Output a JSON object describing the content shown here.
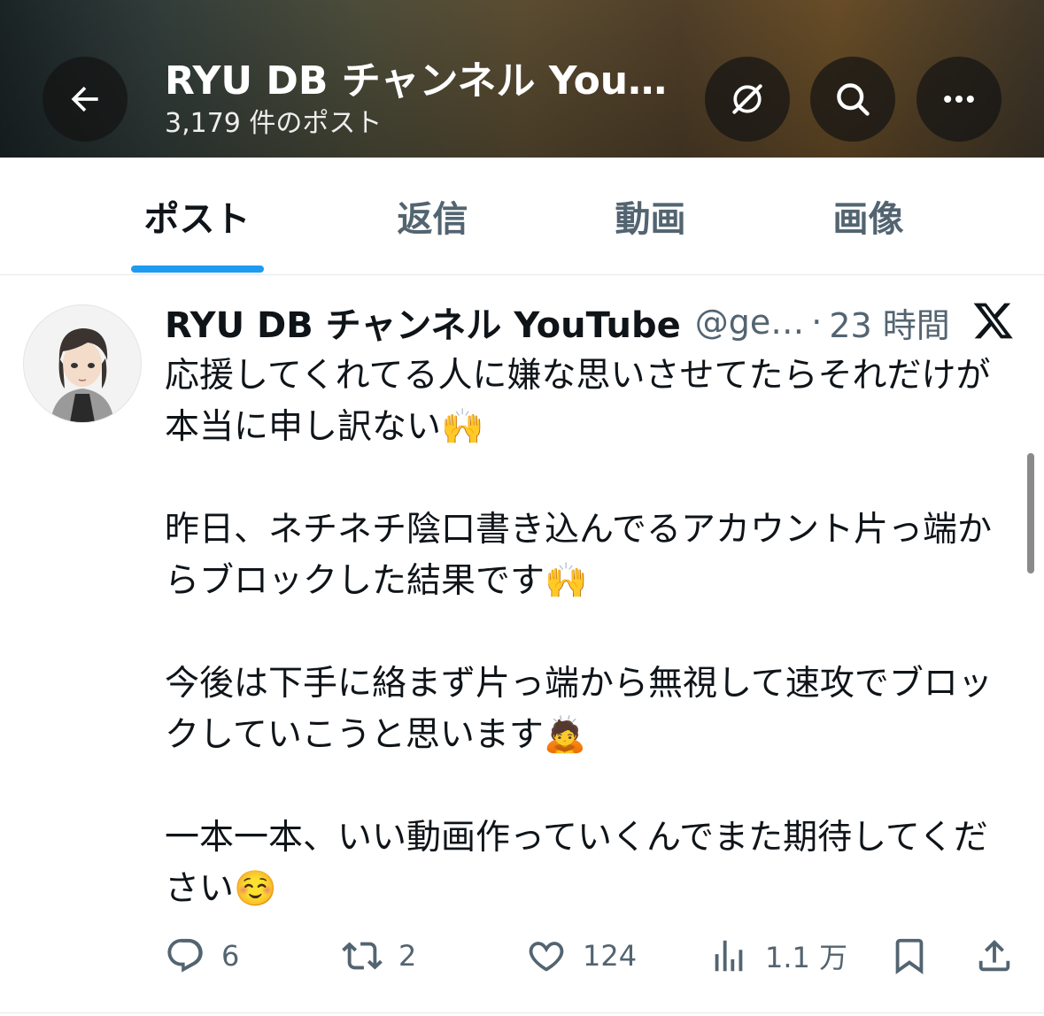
{
  "header": {
    "back_icon": "arrow-left-icon",
    "title": "RYU DB チャンネル YouTube",
    "post_count": "3,179 件のポスト",
    "grok_icon": "grok-icon",
    "search_icon": "search-icon",
    "more_icon": "more-icon"
  },
  "tabs": [
    {
      "label": "ポスト",
      "active": true
    },
    {
      "label": "返信",
      "active": false
    },
    {
      "label": "動画",
      "active": false
    },
    {
      "label": "画像",
      "active": false
    }
  ],
  "post": {
    "author_name": "RYU DB チャンネル YouTube",
    "handle": "@ge…",
    "separator": "·",
    "time": "23 時間",
    "body": [
      "応援してくれてる人に嫌な思いさせてたらそれだけが本当に申し訳ない🙌",
      "昨日、ネチネチ陰口書き込んでるアカウント片っ端からブロックした結果です🙌",
      "今後は下手に絡まず片っ端から無視して速攻でブロックしていこうと思います🙇",
      "一本一本、いい動画作っていくんでまた期待してください☺️"
    ],
    "actions": {
      "replies": "6",
      "reposts": "2",
      "likes": "124",
      "views": "1.1 万"
    }
  },
  "colors": {
    "accent": "#1d9bf0",
    "text": "#0f1419",
    "muted": "#536471"
  }
}
